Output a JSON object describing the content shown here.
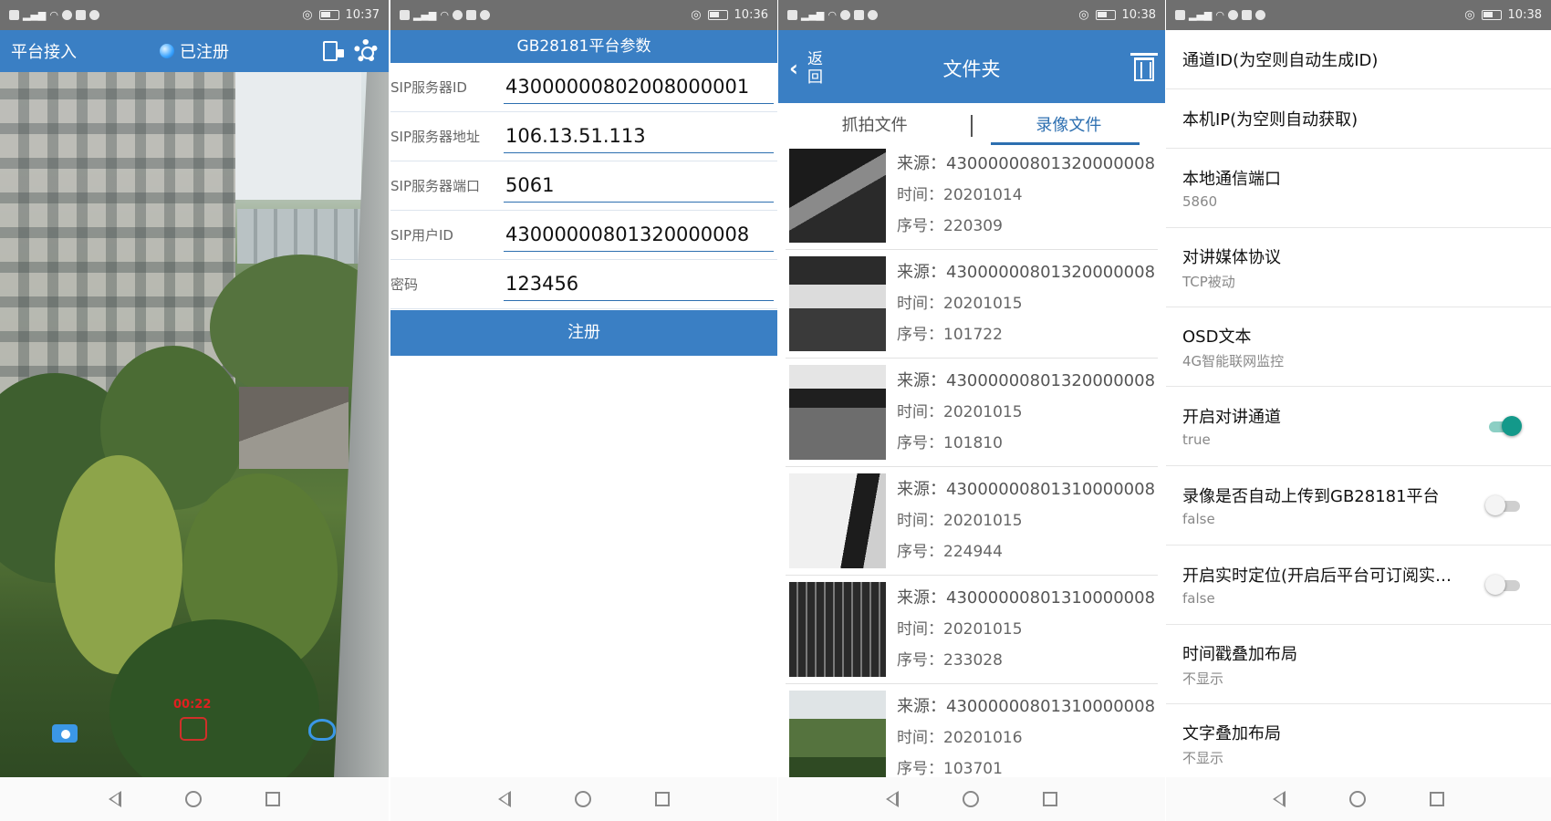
{
  "status_times": [
    "10:37",
    "10:36",
    "10:38",
    "10:38"
  ],
  "panel1": {
    "title": "平台接入",
    "status": "已注册",
    "rec_time": "00:22"
  },
  "panel2": {
    "title": "GB28181平台参数",
    "fields": [
      {
        "label": "SIP服务器ID",
        "value": "43000000802008000001"
      },
      {
        "label": "SIP服务器地址",
        "value": "106.13.51.113"
      },
      {
        "label": "SIP服务器端口",
        "value": "5061"
      },
      {
        "label": "SIP用户ID",
        "value": "43000000801320000008"
      },
      {
        "label": "密码",
        "value": "123456"
      }
    ],
    "register_label": "注册"
  },
  "panel3": {
    "back_label": "返回",
    "title": "文件夹",
    "tabs": [
      "抓拍文件",
      "录像文件"
    ],
    "files": [
      {
        "source": "来源：43000000801320000008",
        "time": "时间：20201014",
        "seq": "序号：220309"
      },
      {
        "source": "来源：43000000801320000008",
        "time": "时间：20201015",
        "seq": "序号：101722"
      },
      {
        "source": "来源：43000000801320000008",
        "time": "时间：20201015",
        "seq": "序号：101810"
      },
      {
        "source": "来源：43000000801310000008",
        "time": "时间：20201015",
        "seq": "序号：224944"
      },
      {
        "source": "来源：43000000801310000008",
        "time": "时间：20201015",
        "seq": "序号：233028"
      },
      {
        "source": "来源：43000000801310000008",
        "time": "时间：20201016",
        "seq": "序号：103701"
      }
    ]
  },
  "panel4": {
    "settings": [
      {
        "title": "通道ID(为空则自动生成ID)",
        "sub": ""
      },
      {
        "title": "本机IP(为空则自动获取)",
        "sub": ""
      },
      {
        "title": "本地通信端口",
        "sub": "5860"
      },
      {
        "title": "对讲媒体协议",
        "sub": "TCP被动"
      },
      {
        "title": "OSD文本",
        "sub": "4G智能联网监控"
      },
      {
        "title": "开启对讲通道",
        "sub": "true",
        "toggle": true
      },
      {
        "title": "录像是否自动上传到GB28181平台",
        "sub": "false",
        "toggle": false
      },
      {
        "title": "开启实时定位(开启后平台可订阅实…",
        "sub": "false",
        "toggle": false
      },
      {
        "title": "时间戳叠加布局",
        "sub": "不显示"
      },
      {
        "title": "文字叠加布局",
        "sub": "不显示"
      }
    ]
  },
  "colors": {
    "primary": "#3a7fc4",
    "toggle_on": "#13998a"
  }
}
